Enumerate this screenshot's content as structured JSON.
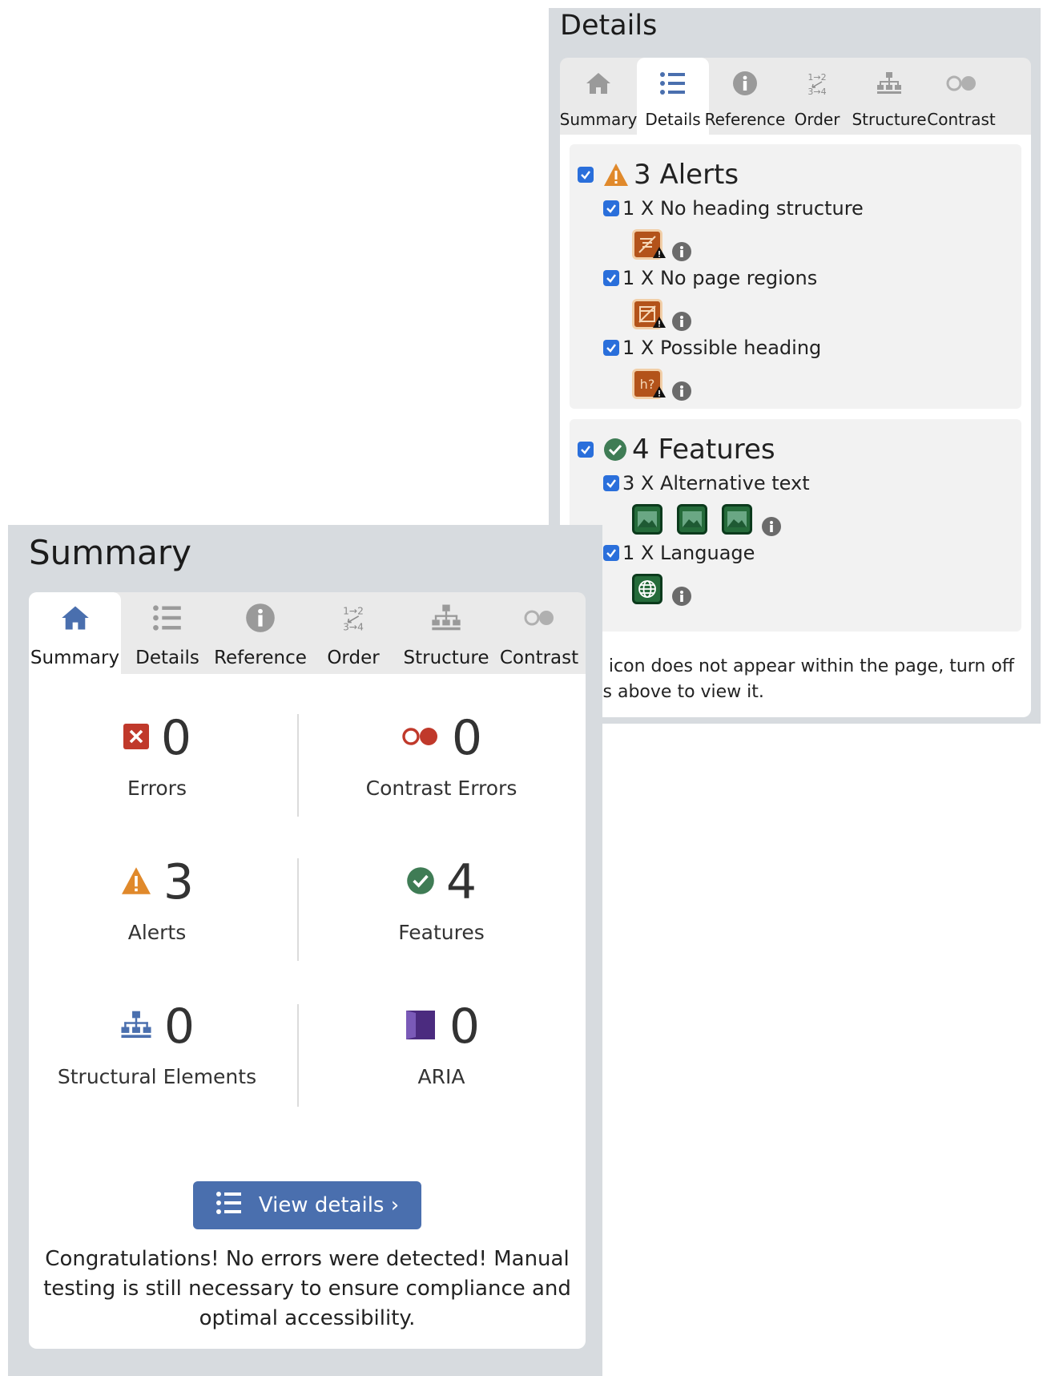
{
  "details_panel": {
    "title": "Details",
    "tabs": [
      {
        "label": "Summary",
        "icon": "home-icon"
      },
      {
        "label": "Details",
        "icon": "list-icon",
        "active": true
      },
      {
        "label": "Reference",
        "icon": "info-icon"
      },
      {
        "label": "Order",
        "icon": "order-icon"
      },
      {
        "label": "Structure",
        "icon": "structure-icon"
      },
      {
        "label": "Contrast",
        "icon": "contrast-icon"
      }
    ],
    "alerts": {
      "heading": "3 Alerts",
      "checked": true,
      "items": [
        {
          "label": "1 X No heading structure",
          "icon": "no-heading-structure-icon",
          "checked": true
        },
        {
          "label": "1 X No page regions",
          "icon": "no-page-regions-icon",
          "checked": true
        },
        {
          "label": "1 X Possible heading",
          "icon": "possible-heading-icon",
          "icon_text": "h?",
          "checked": true
        }
      ]
    },
    "features": {
      "heading": "4 Features",
      "checked": true,
      "items": [
        {
          "label": "3 X Alternative text",
          "icon": "alt-text-icon",
          "icon_count": 3,
          "checked": true
        },
        {
          "label": "1 X Language",
          "icon": "language-icon",
          "checked": true
        }
      ]
    },
    "note_line1": "n icon does not appear within the page, turn off",
    "note_line2": "es above to view it."
  },
  "summary_panel": {
    "title": "Summary",
    "tabs": [
      {
        "label": "Summary",
        "icon": "home-icon",
        "active": true
      },
      {
        "label": "Details",
        "icon": "list-icon"
      },
      {
        "label": "Reference",
        "icon": "info-icon"
      },
      {
        "label": "Order",
        "icon": "order-icon"
      },
      {
        "label": "Structure",
        "icon": "structure-icon"
      },
      {
        "label": "Contrast",
        "icon": "contrast-icon"
      }
    ],
    "order_icon_text": {
      "top": "1→2",
      "bottom": "3→4"
    },
    "stats": {
      "errors": {
        "value": "0",
        "label": "Errors",
        "icon": "error-icon"
      },
      "contrast_errors": {
        "value": "0",
        "label": "Contrast Errors",
        "icon": "contrast-error-icon"
      },
      "alerts": {
        "value": "3",
        "label": "Alerts",
        "icon": "alert-icon"
      },
      "features": {
        "value": "4",
        "label": "Features",
        "icon": "feature-check-icon"
      },
      "structural": {
        "value": "0",
        "label": "Structural Elements",
        "icon": "structure-icon"
      },
      "aria": {
        "value": "0",
        "label": "ARIA",
        "icon": "aria-icon"
      }
    },
    "view_details_label": "View details ›",
    "congrats": "Congratulations! No errors were detected! Manual testing is still necessary to ensure compliance and optimal accessibility."
  },
  "colors": {
    "panel_bg": "#d7dbdf",
    "active_tab_icon": "#4a6fae",
    "inactive_tab_icon": "#9a9a9a",
    "alert_orange": "#e0892b",
    "feature_green": "#3f7c55",
    "error_red": "#c0392b",
    "checkbox_blue": "#2a6fdb",
    "aria_purple": "#4b2b7f",
    "button_blue": "#4a6fae"
  }
}
